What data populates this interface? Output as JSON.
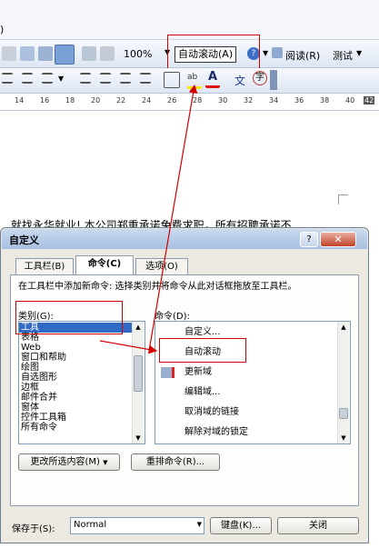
{
  "toolbar1": {
    "zoom": "100%",
    "autoscroll_label": "自动滚动(A)",
    "read_label": "阅读(R)",
    "test_label": "测试"
  },
  "toolbar2": {
    "highlight_icon": "highlighter-icon",
    "font_color_icon": "font-color-icon",
    "phonetic_label": "文",
    "enclose_label": "字"
  },
  "ruler": {
    "ticks": [
      "14",
      "16",
      "18",
      "20",
      "22",
      "24",
      "26",
      "28",
      "30",
      "32",
      "34",
      "36",
      "38",
      "40",
      "42"
    ]
  },
  "document": {
    "partial_text": "就找永华就业! 本公司郑重承诺免费求职，所有招聘承诺不"
  },
  "dialog": {
    "title": "自定义",
    "tabs": [
      "工具栏(B)",
      "命令(C)",
      "选项(O)"
    ],
    "instruction": "在工具栏中添加新命令: 选择类别并将命令从此对话框拖放至工具栏。",
    "categories_label": "类别(G):",
    "commands_label": "命令(D):",
    "categories": [
      "工具",
      "表格",
      "Web",
      "窗口和帮助",
      "绘图",
      "自选图形",
      "边框",
      "邮件合并",
      "窗体",
      "控件工具箱",
      "所有命令"
    ],
    "commands": [
      "自定义...",
      "自动滚动",
      "更新域",
      "编辑域...",
      "取消域的链接",
      "解除对域的锁定"
    ],
    "modify_button": "更改所选内容(M)",
    "rearrange_button": "重排命令(R)...",
    "save_in_label": "保存于(S):",
    "save_in_value": "Normal",
    "keyboard_button": "键盘(K)...",
    "close_button": "关闭"
  }
}
